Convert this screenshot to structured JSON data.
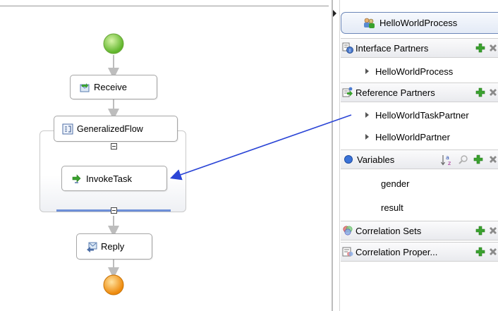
{
  "process": {
    "nodes": {
      "receive": "Receive",
      "generalized_flow": "GeneralizedFlow",
      "invoke_task": "InvokeTask",
      "reply": "Reply"
    }
  },
  "panel": {
    "process_tab": "HelloWorldProcess",
    "interface_partners": {
      "label": "Interface Partners",
      "items": [
        "HelloWorldProcess"
      ]
    },
    "reference_partners": {
      "label": "Reference Partners",
      "items": [
        "HelloWorldTaskPartner",
        "HelloWorldPartner"
      ]
    },
    "variables": {
      "label": "Variables",
      "items": [
        "gender",
        "result"
      ]
    },
    "correlation_sets": {
      "label": "Correlation Sets"
    },
    "correlation_properties": {
      "label": "Correlation Proper..."
    }
  },
  "colors": {
    "start_node": "#8fd14a",
    "end_node": "#f5a623",
    "connection_arrow": "#2b45d6",
    "add_green": "#3aa22e",
    "panel_tab_border": "#6b86b8"
  },
  "icons": {
    "receive": "receive-icon",
    "flow": "flow-icon",
    "invoke": "invoke-icon",
    "reply": "reply-icon",
    "add": "plus-icon",
    "delete": "x-icon",
    "sort": "sort-az-icon",
    "search": "search-icon"
  }
}
